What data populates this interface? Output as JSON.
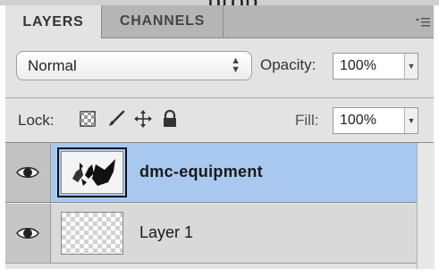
{
  "window": {
    "clipped_heading": "prop"
  },
  "tabs": [
    {
      "label": "LAYERS",
      "active": true
    },
    {
      "label": "CHANNELS",
      "active": false
    }
  ],
  "blend_mode": {
    "selected": "Normal"
  },
  "opacity": {
    "label": "Opacity:",
    "value": "100%"
  },
  "lock": {
    "label": "Lock:",
    "icons": [
      "lock-transparent-pixels-icon",
      "lock-image-pixels-icon",
      "lock-position-icon",
      "lock-all-icon"
    ]
  },
  "fill": {
    "label": "Fill:",
    "value": "100%"
  },
  "layers": [
    {
      "name": "dmc-equipment",
      "visible": true,
      "selected": true
    },
    {
      "name": "Layer 1",
      "visible": true,
      "selected": false
    }
  ],
  "colors": {
    "selected_row": "#a9c8ef",
    "panel_bg": "#e3e3e3",
    "tab_bar": "#b5b5b5"
  }
}
